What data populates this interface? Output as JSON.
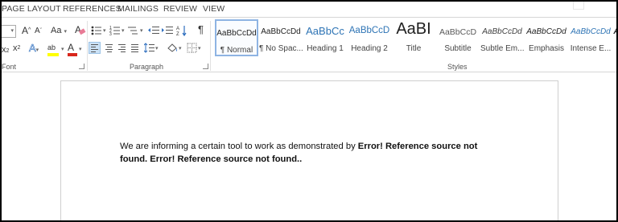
{
  "tabs": [
    "PAGE LAYOUT",
    "REFERENCES",
    "MAILINGS",
    "REVIEW",
    "VIEW"
  ],
  "font_group": {
    "label": "Font",
    "grow_glyph": "A",
    "shrink_glyph": "A",
    "change_case": "Aa",
    "subscript": "x",
    "superscript": "x",
    "text_effects_glyph": "A",
    "highlight_glyph": "ab",
    "font_color_glyph": "A",
    "highlight_color": "#ffff00",
    "font_color": "#d9261c"
  },
  "paragraph_group": {
    "label": "Paragraph",
    "show_marks": "¶"
  },
  "styles_group": {
    "label": "Styles",
    "items": [
      {
        "preview": "AaBbCcDd",
        "name": "¶ Normal"
      },
      {
        "preview": "AaBbCcDd",
        "name": "¶ No Spac..."
      },
      {
        "preview": "AaBbCc",
        "name": "Heading 1"
      },
      {
        "preview": "AaBbCcD",
        "name": "Heading 2"
      },
      {
        "preview": "AaBI",
        "name": "Title"
      },
      {
        "preview": "AaBbCcD",
        "name": "Subtitle"
      },
      {
        "preview": "AaBbCcDd",
        "name": "Subtle Em..."
      },
      {
        "preview": "AaBbCcDd",
        "name": "Emphasis"
      },
      {
        "preview": "AaBbCcDd",
        "name": "Intense E..."
      },
      {
        "preview": "A",
        "name": ""
      }
    ],
    "heading_color": "#2e74b5"
  },
  "document": {
    "text_plain": "We are informing a certain tool to work as demonstrated by ",
    "text_error_1": "Error! Reference source not found.",
    "text_error_2": "Error! Reference source not found.",
    "text_end": "."
  }
}
